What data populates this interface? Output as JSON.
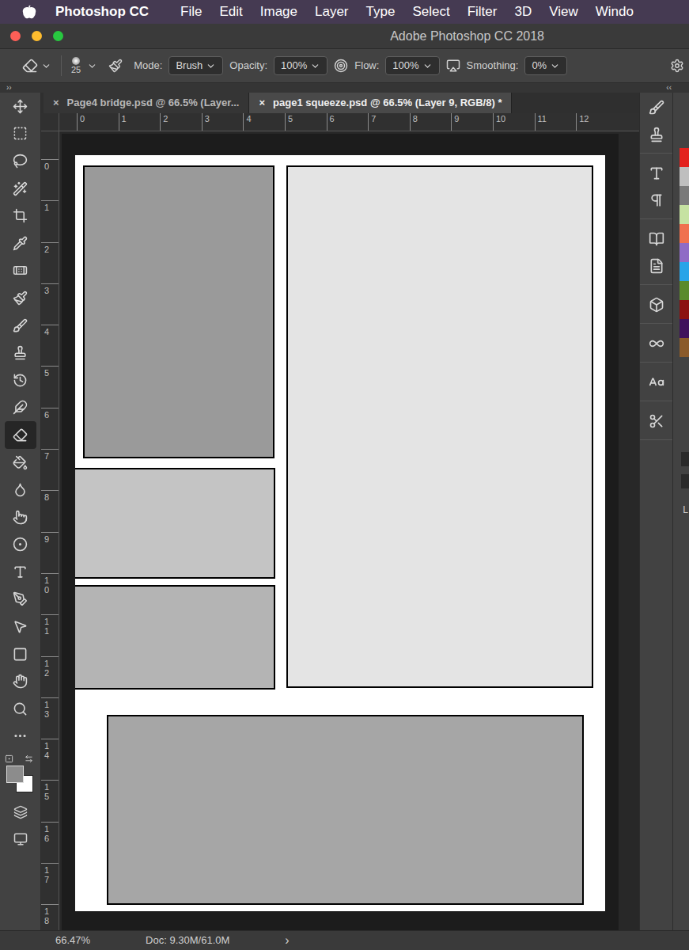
{
  "menubar": {
    "app": "Photoshop CC",
    "items": [
      "File",
      "Edit",
      "Image",
      "Layer",
      "Type",
      "Select",
      "Filter",
      "3D",
      "View",
      "Windo"
    ]
  },
  "window": {
    "title": "Adobe Photoshop CC 2018"
  },
  "options": {
    "brush_size": "25",
    "mode_label": "Mode:",
    "mode": "Brush",
    "opacity_label": "Opacity:",
    "opacity": "100%",
    "flow_label": "Flow:",
    "flow": "100%",
    "smoothing_label": "Smoothing:",
    "smoothing": "0%"
  },
  "panel_toggles": {
    "left": "››",
    "right": "‹‹"
  },
  "tabs": [
    {
      "label": "Page4 bridge.psd @ 66.5% (Layer...",
      "selected": false,
      "close": "×"
    },
    {
      "label": "page1 squeeze.psd @ 66.5% (Layer 9, RGB/8) *",
      "selected": true,
      "close": "×"
    }
  ],
  "ruler": {
    "horizontal": [
      "0",
      "1",
      "2",
      "3",
      "4",
      "5",
      "6",
      "7",
      "8",
      "9",
      "10",
      "11",
      "12"
    ],
    "vertical": [
      "0",
      "1",
      "2",
      "3",
      "4",
      "5",
      "6",
      "7",
      "8",
      "9",
      "10",
      "11",
      "12",
      "13",
      "14",
      "15",
      "16",
      "17",
      "18"
    ]
  },
  "toolbar": {
    "tools": [
      {
        "selected": false
      },
      {
        "selected": false
      },
      {
        "selected": false
      },
      {
        "selected": false
      },
      {
        "selected": false
      },
      {
        "selected": false
      },
      {
        "selected": false
      },
      {
        "selected": false
      },
      {
        "selected": false
      },
      {
        "selected": false
      },
      {
        "selected": false
      },
      {
        "selected": false
      },
      {
        "selected": true
      },
      {
        "selected": false
      },
      {
        "selected": false
      },
      {
        "selected": false
      },
      {
        "selected": false
      },
      {
        "selected": false
      },
      {
        "selected": false
      },
      {
        "selected": false
      },
      {
        "selected": false
      },
      {
        "selected": false
      },
      {
        "selected": false
      },
      {
        "selected": false
      }
    ],
    "colors": {
      "foreground": "#8c8c8c",
      "background": "#ffffff"
    }
  },
  "swatches": [
    {
      "color": "#e3221e"
    },
    {
      "color": "#bfbfbf"
    },
    {
      "color": "#7a7a7a"
    },
    {
      "color": "#c6e2a2"
    },
    {
      "color": "#f0714f"
    },
    {
      "color": "#8f6cc6"
    },
    {
      "color": "#28a4e8"
    },
    {
      "color": "#5a8a2c"
    },
    {
      "color": "#8c1212"
    },
    {
      "color": "#40115c"
    },
    {
      "color": "#8a5a2a"
    }
  ],
  "right_panel": {
    "label_fragment": "L"
  },
  "status_bar": {
    "zoom": "66.47%",
    "doc": "Doc: 9.30M/61.0M",
    "arrow": "›"
  }
}
